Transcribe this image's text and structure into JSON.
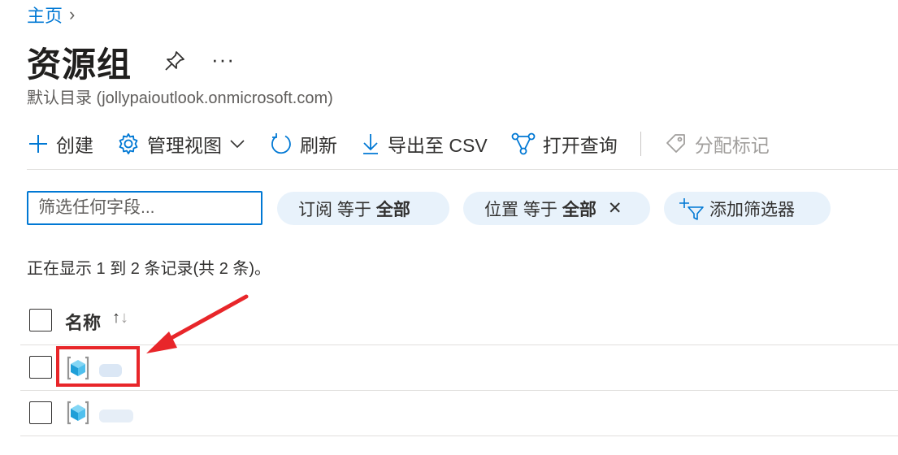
{
  "breadcrumb": {
    "home": "主页",
    "separator": "›"
  },
  "page": {
    "title": "资源组",
    "more": "···",
    "subtitle": "默认目录 (jollypaioutlook.onmicrosoft.com)"
  },
  "toolbar": {
    "create": "创建",
    "manage_view": "管理视图",
    "refresh": "刷新",
    "export_csv": "导出至 CSV",
    "open_query": "打开查询",
    "assign_tags": "分配标记"
  },
  "filters": {
    "search_placeholder": "筛选任何字段...",
    "subscription": {
      "label": "订阅 等于",
      "value": "全部"
    },
    "location": {
      "label": "位置 等于",
      "value": "全部",
      "close": "✕"
    },
    "add_filter": "添加筛选器"
  },
  "record_count": "正在显示 1 到 2 条记录(共 2 条)。",
  "table": {
    "columns": [
      "名称"
    ],
    "sort_up": "↑",
    "sort_down": "↓",
    "rows": [
      {
        "icon": "resource-group-icon",
        "name_redacted": true
      },
      {
        "icon": "resource-group-icon",
        "name_redacted": true
      }
    ]
  },
  "annotation": {
    "highlight_color": "#e8262a"
  },
  "colors": {
    "accent": "#0078d4",
    "pill_bg": "#e8f2fb",
    "disabled": "#a19f9d"
  }
}
